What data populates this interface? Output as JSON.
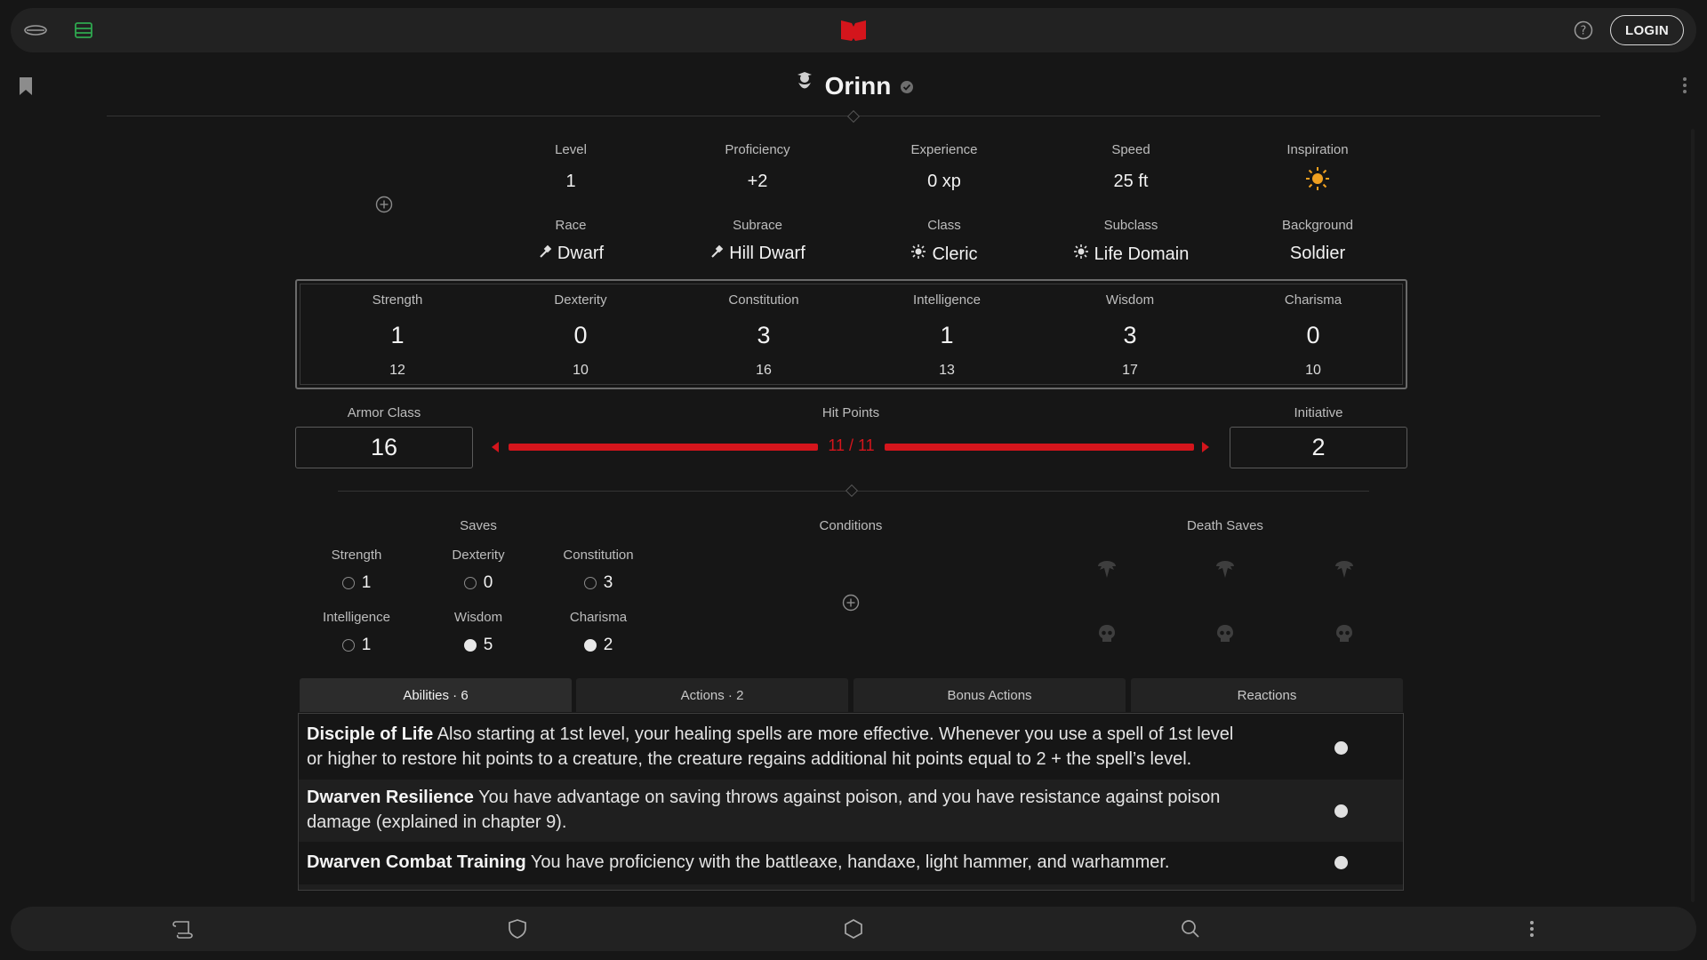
{
  "app": {
    "login_label": "LOGIN",
    "brand_color": "#d4151c"
  },
  "character": {
    "name": "Orinn"
  },
  "info": [
    {
      "label": "Level",
      "value": "1"
    },
    {
      "label": "Proficiency",
      "value": "+2"
    },
    {
      "label": "Experience",
      "value": "0 xp"
    },
    {
      "label": "Speed",
      "value": "25 ft"
    },
    {
      "label": "Inspiration",
      "value": ""
    },
    {
      "label": "Race",
      "value": "Dwarf"
    },
    {
      "label": "Subrace",
      "value": "Hill Dwarf"
    },
    {
      "label": "Class",
      "value": "Cleric"
    },
    {
      "label": "Subclass",
      "value": "Life Domain"
    },
    {
      "label": "Background",
      "value": "Soldier"
    }
  ],
  "abilities": [
    {
      "name": "Strength",
      "mod": "1",
      "score": "12"
    },
    {
      "name": "Dexterity",
      "mod": "0",
      "score": "10"
    },
    {
      "name": "Constitution",
      "mod": "3",
      "score": "16"
    },
    {
      "name": "Intelligence",
      "mod": "1",
      "score": "13"
    },
    {
      "name": "Wisdom",
      "mod": "3",
      "score": "17"
    },
    {
      "name": "Charisma",
      "mod": "0",
      "score": "10"
    }
  ],
  "combat": {
    "ac_label": "Armor Class",
    "ac_value": "16",
    "hp_label": "Hit Points",
    "hp_text": "11 / 11",
    "hp_fraction": 1.0,
    "init_label": "Initiative",
    "init_value": "2"
  },
  "saves": {
    "title": "Saves",
    "items": [
      {
        "name": "Strength",
        "value": "1",
        "proficient": false
      },
      {
        "name": "Dexterity",
        "value": "0",
        "proficient": false
      },
      {
        "name": "Constitution",
        "value": "3",
        "proficient": false
      },
      {
        "name": "Intelligence",
        "value": "1",
        "proficient": false
      },
      {
        "name": "Wisdom",
        "value": "5",
        "proficient": true
      },
      {
        "name": "Charisma",
        "value": "2",
        "proficient": true
      }
    ]
  },
  "conditions": {
    "title": "Conditions"
  },
  "death_saves": {
    "title": "Death Saves",
    "successes": 0,
    "failures": 0
  },
  "tabs": [
    {
      "label": "Abilities · 6",
      "active": true
    },
    {
      "label": "Actions · 2",
      "active": false
    },
    {
      "label": "Bonus Actions",
      "active": false
    },
    {
      "label": "Reactions",
      "active": false
    }
  ],
  "features": [
    {
      "name": "Disciple of Life",
      "text": "Also starting at 1st level, your healing spells are more effective. Whenever you use a spell of 1st level or higher to restore hit points to a creature, the creature regains additional hit points equal to 2 + the spell’s level."
    },
    {
      "name": "Dwarven Resilience",
      "text": "You have advantage on saving throws against poison, and you have resistance against poison damage (explained in chapter 9)."
    },
    {
      "name": "Dwarven Combat Training",
      "text": "You have proficiency with the battleaxe, handaxe, light hammer, and warhammer."
    }
  ]
}
